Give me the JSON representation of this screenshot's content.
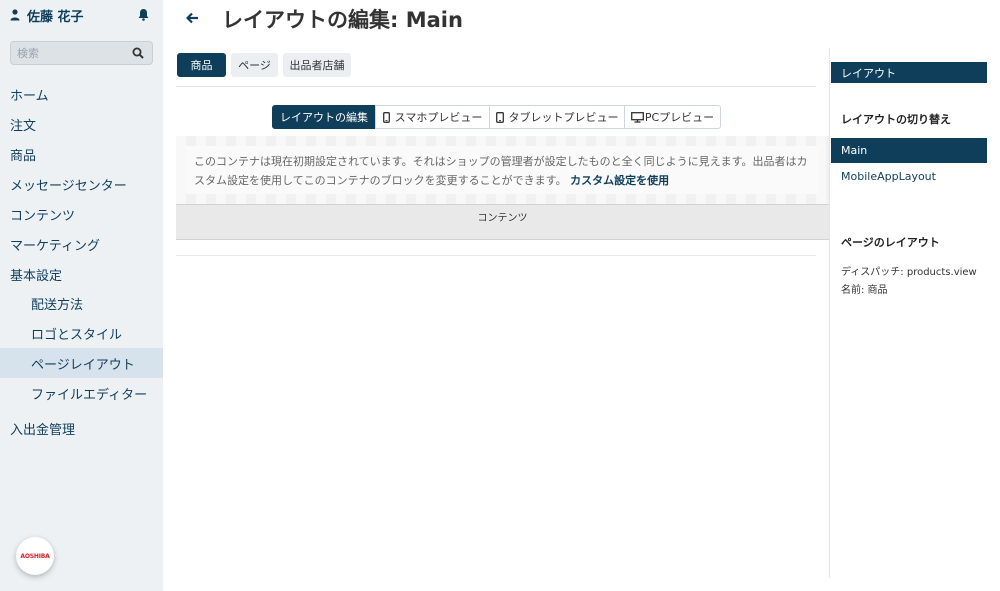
{
  "user": {
    "name": "佐藤 花子"
  },
  "search": {
    "placeholder": "検索"
  },
  "sidebar": {
    "items": [
      {
        "label": "ホーム"
      },
      {
        "label": "注文"
      },
      {
        "label": "商品"
      },
      {
        "label": "メッセージセンター"
      },
      {
        "label": "コンテンツ"
      },
      {
        "label": "マーケティング"
      },
      {
        "label": "基本設定"
      },
      {
        "label": "配送方法"
      },
      {
        "label": "ロゴとスタイル"
      },
      {
        "label": "ページレイアウト"
      },
      {
        "label": "ファイルエディター"
      },
      {
        "label": "入出金管理"
      }
    ]
  },
  "logo": {
    "text": "AOSHIBA"
  },
  "header": {
    "title": "レイアウトの編集: Main"
  },
  "tabs": {
    "products": "商品",
    "pages": "ページ",
    "vendor": "出品者店舗"
  },
  "preview": {
    "edit": "レイアウトの編集",
    "phone": "スマホプレビュー",
    "tablet": "タブレットプレビュー",
    "pc": "PCプレビュー"
  },
  "notice": {
    "text": "このコンテナは現在初期設定されています。それはショップの管理者が設定したものと全く同じように見えます。出品者はカスタム設定を使用してこのコンテナのブロックを変更することができます。",
    "link": "カスタム設定を使用"
  },
  "container": {
    "label": "コンテンツ"
  },
  "right_panel": {
    "header": "レイアウト",
    "switch_title": "レイアウトの切り替え",
    "layouts": [
      "Main",
      "MobileAppLayout"
    ],
    "page_layout_title": "ページのレイアウト",
    "dispatch": "ディスパッチ: products.view",
    "name": "名前: 商品"
  },
  "colors": {
    "accent": "#0f3e5b",
    "sidebar_bg": "#edf1f4",
    "active_nav": "#d6e2ec"
  }
}
